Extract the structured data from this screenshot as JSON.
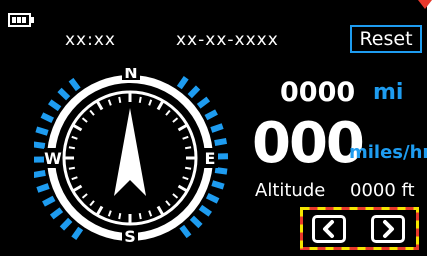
{
  "status_bar": {
    "battery_icon": "battery-full-icon",
    "time": "xx:xx",
    "date": "xx-xx-xxxx",
    "reset_label": "Reset"
  },
  "compass": {
    "north": "N",
    "east": "E",
    "south": "S",
    "west": "W",
    "needle_icon": "north-arrow-icon"
  },
  "distance": {
    "value": "0000",
    "unit": "mi"
  },
  "speed": {
    "value": "000",
    "unit": "miles/hr"
  },
  "altitude": {
    "label": "Altitude",
    "value": "0000 ft"
  },
  "nav": {
    "prev_icon": "chevron-left-icon",
    "next_icon": "chevron-right-icon"
  },
  "colors": {
    "accent": "#1e9cf0",
    "background": "#000000",
    "highlight_red": "#e8392c",
    "highlight_yellow": "#f5e600"
  }
}
